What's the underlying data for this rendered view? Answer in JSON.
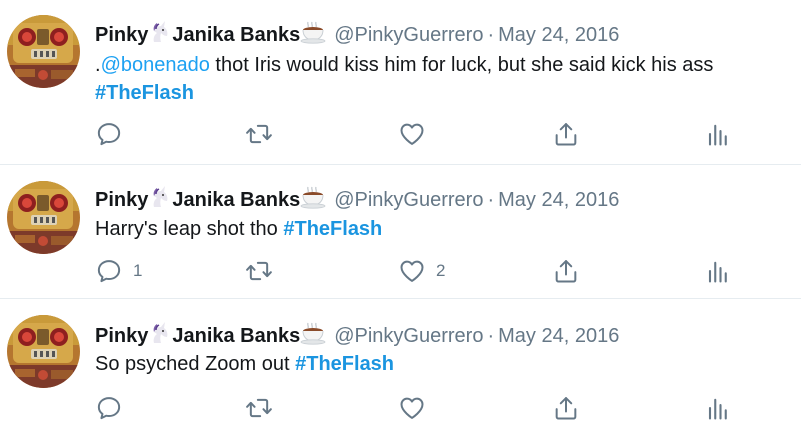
{
  "tweets": [
    {
      "user": {
        "name_first": "Pinky",
        "name_last": "Janika Banks",
        "handle": "@PinkyGuerrero"
      },
      "separator": "·",
      "date": "May 24, 2016",
      "text": {
        "prefix": ".",
        "mention": "@bonenado",
        "middle": " thot Iris would kiss him for luck, but she said kick his ass",
        "hashtag": "#TheFlash"
      },
      "counts": {
        "reply": "",
        "like": ""
      }
    },
    {
      "user": {
        "name_first": "Pinky",
        "name_last": "Janika Banks",
        "handle": "@PinkyGuerrero"
      },
      "separator": "·",
      "date": "May 24, 2016",
      "text": {
        "main": "Harry's leap shot tho ",
        "hashtag": "#TheFlash"
      },
      "counts": {
        "reply": "1",
        "like": "2"
      }
    },
    {
      "user": {
        "name_first": "Pinky",
        "name_last": "Janika Banks",
        "handle": "@PinkyGuerrero"
      },
      "separator": "·",
      "date": "May 24, 2016",
      "text": {
        "main": "So psyched Zoom out ",
        "hashtag": "#TheFlash"
      },
      "counts": {
        "reply": "",
        "like": ""
      }
    }
  ],
  "icons": {
    "reply": "reply-icon",
    "retweet": "retweet-icon",
    "like": "heart-icon",
    "share": "share-icon",
    "analytics": "analytics-icon",
    "name_emoji": "unicorn-emoji",
    "suffix_emoji": "hot-beverage-emoji"
  },
  "colors": {
    "text": "#14171a",
    "muted": "#657786",
    "link": "#1da1f2",
    "divider": "#e6ecf0"
  }
}
